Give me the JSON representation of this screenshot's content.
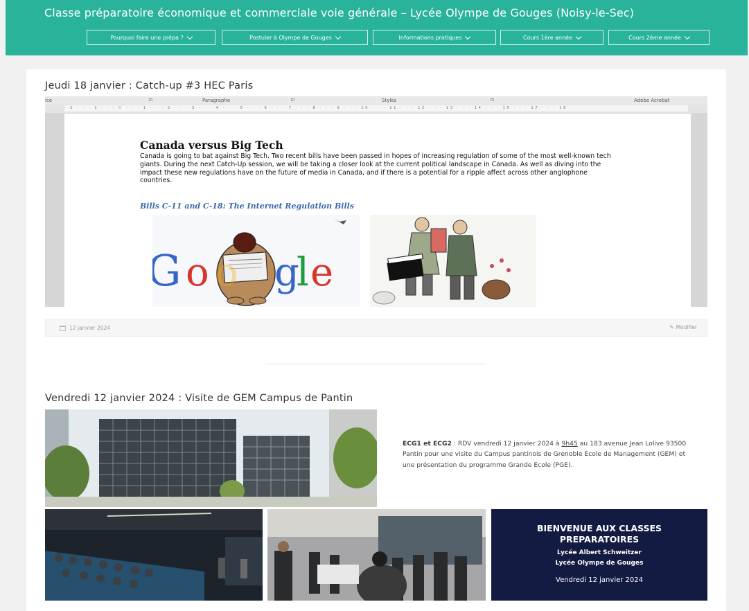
{
  "site": {
    "title": "Classe préparatoire économique et commerciale voie générale – Lycée Olympe de Gouges (Noisy-le-Sec)",
    "accent_color": "#28b39a"
  },
  "nav": [
    {
      "label": "Pourquoi faire une prépa ?"
    },
    {
      "label": "Postuler à Olympe de Gouges"
    },
    {
      "label": "Informations pratiques"
    },
    {
      "label": "Cours 1ère année"
    },
    {
      "label": "Cours 2ème année"
    }
  ],
  "post1": {
    "title": "Jeudi 18 janvier : Catch-up #3 HEC Paris",
    "date": "12 janvier 2024",
    "edit_label": "Modifier",
    "word": {
      "ribbon": [
        "ice",
        "Paragraphe",
        "Styles",
        "Adobe Acrobat"
      ],
      "heading": "Canada versus Big Tech",
      "body": "Canada is going to bat against Big Tech. Two recent bills have been passed in hopes of increasing regulation of some of the most well-known tech giants. During the next Catch-Up session, we will be taking a closer look at the current political landscape in Canada. As well as diving into the impact these new regulations have on the future of media in Canada, and if there is a potential for a ripple affect across other anglophone countries.",
      "subheading": "Bills C-11 and C-18: The Internet Regulation Bills",
      "cartoon_text": "Google"
    }
  },
  "post2": {
    "title": "Vendredi 12 janvier 2024 : Visite de GEM Campus de Pantin",
    "lead_bold": "ECG1 et ECG2",
    "text_before_time": " : RDV vendredi 12 janvier 2024 à ",
    "time": "9h45",
    "text_after_time": " au 183 avenue Jean Lolive 93500 Pantin pour une visite du Campus pantinois de Grenoble Ecole de Management (GEM) et une présentation du programme Grande Ecole (PGE).",
    "welcome_slide": {
      "line1": "BIENVENUE AUX CLASSES",
      "line2": "PREPARATOIRES",
      "line3": "Lycée Albert Schweitzer",
      "line4": "Lycée Olympe de Gouges",
      "line5": "Vendredi 12 janvier 2024"
    }
  }
}
